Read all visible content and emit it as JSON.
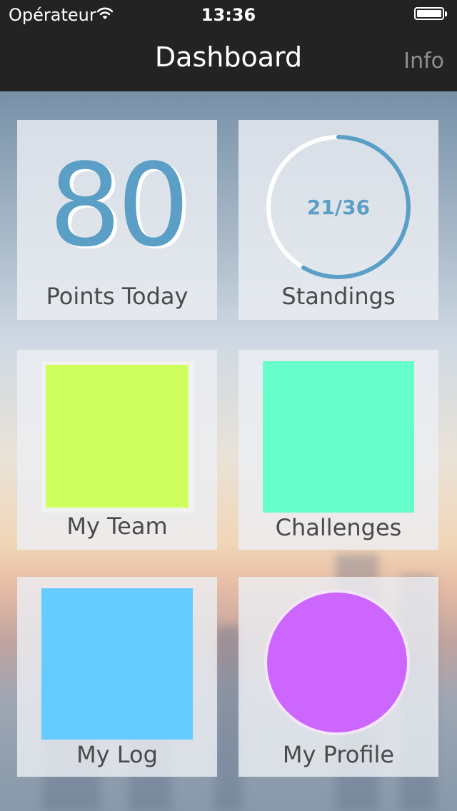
{
  "status_bar": {
    "carrier": "Opérateur",
    "time": "13:36"
  },
  "nav": {
    "title": "Dashboard",
    "info_label": "Info"
  },
  "tiles": {
    "points": {
      "value": "80",
      "label": "Points Today"
    },
    "standings": {
      "text": "21/36",
      "label": "Standings",
      "progress": 0.5833
    },
    "team": {
      "label": "My Team",
      "color": "#cfff5f"
    },
    "challenges": {
      "label": "Challenges",
      "color": "#66ffcc"
    },
    "log": {
      "label": "My Log",
      "color": "#66ccff"
    },
    "profile": {
      "label": "My Profile",
      "color": "#cc66ff"
    }
  },
  "colors": {
    "bar_background": "#232323",
    "accent": "#5b9fc6",
    "ring_track": "#ffffff"
  },
  "icons": [
    "wifi-icon",
    "battery-icon"
  ]
}
